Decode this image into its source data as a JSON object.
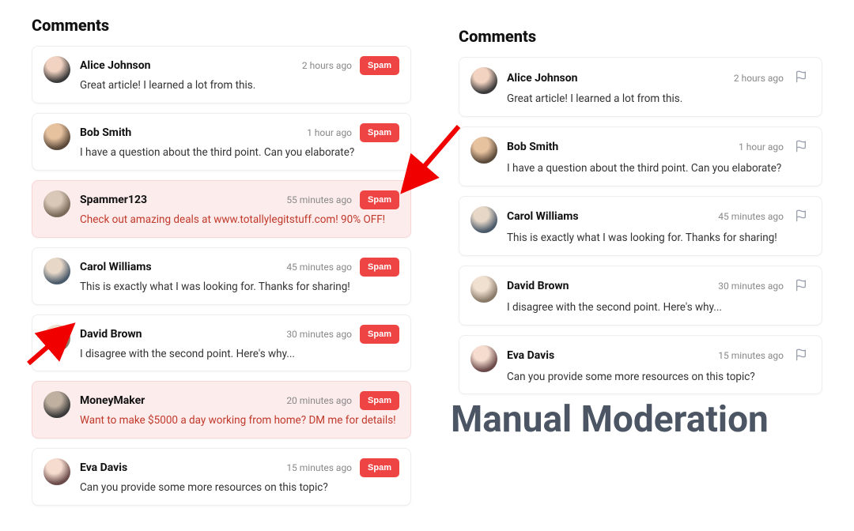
{
  "left": {
    "title": "Comments",
    "spam_button_label": "Spam",
    "comments": [
      {
        "author": "Alice Johnson",
        "time": "2 hours ago",
        "text": "Great article! I learned a lot from this.",
        "spam": false,
        "avatar": "av1"
      },
      {
        "author": "Bob Smith",
        "time": "1 hour ago",
        "text": "I have a question about the third point. Can you elaborate?",
        "spam": false,
        "avatar": "av2"
      },
      {
        "author": "Spammer123",
        "time": "55 minutes ago",
        "text": "Check out amazing deals at www.totallylegitstuff.com! 90% OFF!",
        "spam": true,
        "avatar": "av3"
      },
      {
        "author": "Carol Williams",
        "time": "45 minutes ago",
        "text": "This is exactly what I was looking for. Thanks for sharing!",
        "spam": false,
        "avatar": "av4"
      },
      {
        "author": "David Brown",
        "time": "30 minutes ago",
        "text": "I disagree with the second point. Here's why...",
        "spam": false,
        "avatar": "av5"
      },
      {
        "author": "MoneyMaker",
        "time": "20 minutes ago",
        "text": "Want to make $5000 a day working from home? DM me for details!",
        "spam": true,
        "avatar": "av6"
      },
      {
        "author": "Eva Davis",
        "time": "15 minutes ago",
        "text": "Can you provide some more resources on this topic?",
        "spam": false,
        "avatar": "av7"
      }
    ]
  },
  "right": {
    "title": "Comments",
    "comments": [
      {
        "author": "Alice Johnson",
        "time": "2 hours ago",
        "text": "Great article! I learned a lot from this.",
        "avatar": "av1"
      },
      {
        "author": "Bob Smith",
        "time": "1 hour ago",
        "text": "I have a question about the third point. Can you elaborate?",
        "avatar": "av2"
      },
      {
        "author": "Carol Williams",
        "time": "45 minutes ago",
        "text": "This is exactly what I was looking for. Thanks for sharing!",
        "avatar": "av4"
      },
      {
        "author": "David Brown",
        "time": "30 minutes ago",
        "text": "I disagree with the second point. Here's why...",
        "avatar": "av5"
      },
      {
        "author": "Eva Davis",
        "time": "15 minutes ago",
        "text": "Can you provide some more resources on this topic?",
        "avatar": "av7"
      }
    ]
  },
  "big_label": "Manual Moderation"
}
